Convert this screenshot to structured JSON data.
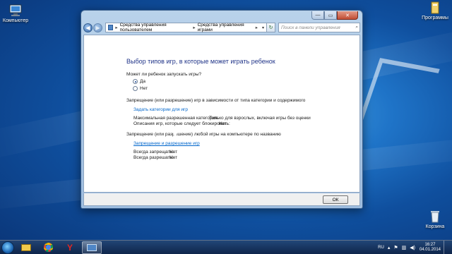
{
  "desktop": {
    "icons": [
      {
        "label": "Компьютер",
        "icon": "computer-icon"
      },
      {
        "label": "Программы",
        "icon": "folder-icon"
      },
      {
        "label": "Корзина",
        "icon": "recycle-bin-icon"
      }
    ]
  },
  "window": {
    "caption_buttons": {
      "minimize": "—",
      "maximize": "▭",
      "close": "✕"
    },
    "address": {
      "crumbs": [
        "Средства управления пользователем",
        "Средства управления играми"
      ],
      "separator": "▸"
    },
    "search_placeholder": "Поиск в панели управления"
  },
  "content": {
    "title": "Выбор типов игр, в которые может играть ребенок",
    "question": "Может ли ребенок запускать игры?",
    "radio_yes": "Да",
    "radio_no": "Нет",
    "selected_option": "Да",
    "section1_heading": "Запрещение (или разрешение) игр в зависимости от типа категории и содержимого",
    "set_category_link": "Задать категории для игр",
    "max_rating_label": "Максимальная разрешенная категория:",
    "max_rating_value": "Только для взрослых, включая игры без оценки",
    "game_desc_label": "Описания игр, которые следует блокировать:",
    "game_desc_value": "Нет",
    "section2_heading": "Запрещение (или разрешение) любой игры на компьютере по названию",
    "allow_block_link": "Запрещение и разрешение игр",
    "always_block_label": "Всегда запрещать:",
    "always_block_value": "Нет",
    "always_allow_label": "Всегда разрешать:",
    "always_allow_value": "Нет"
  },
  "footer": {
    "ok_label": "ОК"
  },
  "taskbar": {
    "items": [
      {
        "icon": "explorer-folder-icon"
      },
      {
        "icon": "chrome-icon"
      },
      {
        "icon": "yandex-browser-icon"
      },
      {
        "icon": "control-panel-icon",
        "active": true
      }
    ],
    "language": "RU",
    "time": "16:27",
    "date": "04.01.2014"
  }
}
